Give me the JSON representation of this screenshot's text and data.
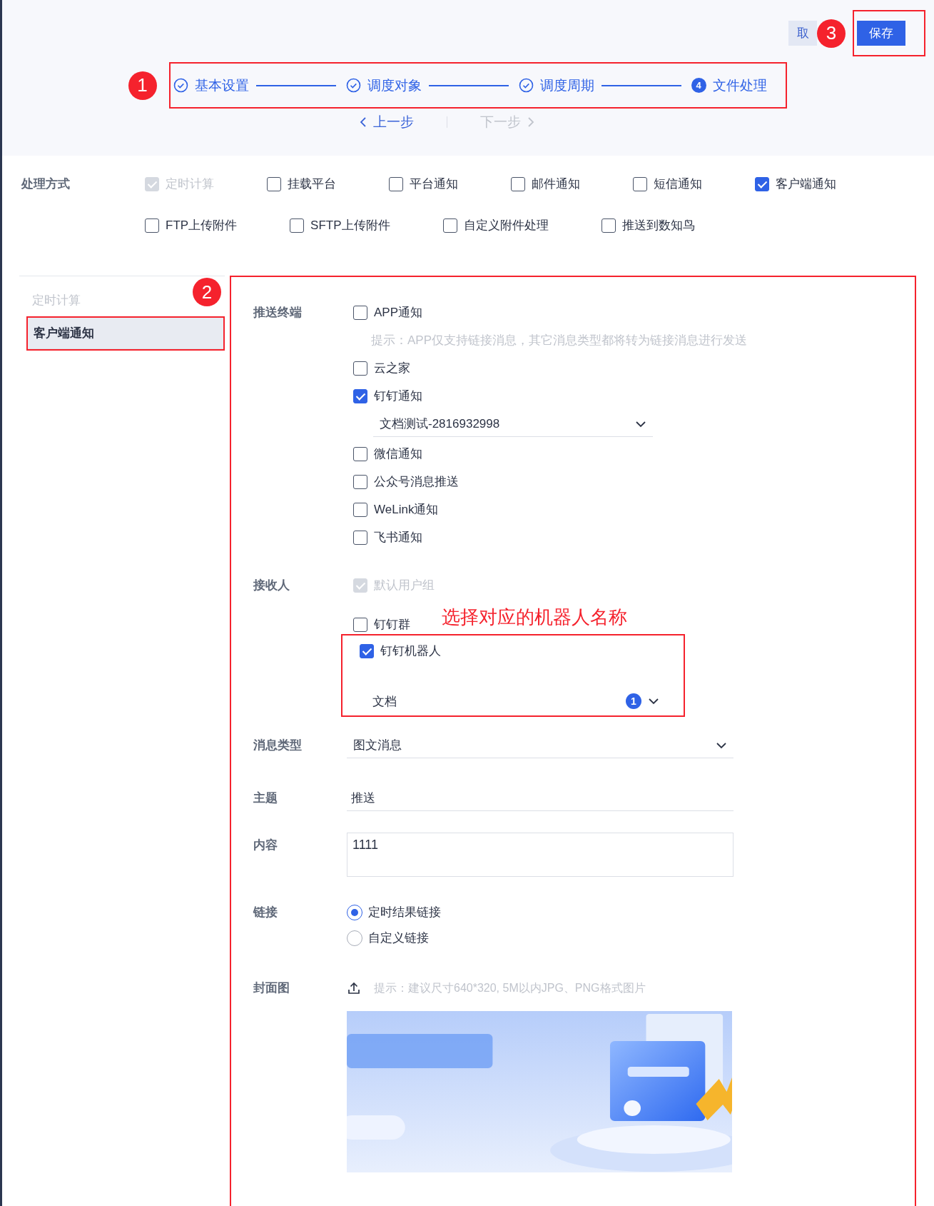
{
  "header": {
    "cancel_button": "取",
    "save_button": "保存",
    "save_callout": "3",
    "steps_callout": "1",
    "steps": [
      {
        "label": "基本设置",
        "done": true
      },
      {
        "label": "调度对象",
        "done": true
      },
      {
        "label": "调度周期",
        "done": true
      },
      {
        "label": "文件处理",
        "done": false,
        "number": "4"
      }
    ],
    "prev_button": {
      "label": "上一步",
      "disabled": false
    },
    "next_button": {
      "label": "下一步",
      "disabled": true
    }
  },
  "methods": {
    "label": "处理方式",
    "options": [
      {
        "label": "定时计算",
        "checked": true,
        "disabled": true
      },
      {
        "label": "挂载平台",
        "checked": false,
        "disabled": false
      },
      {
        "label": "平台通知",
        "checked": false,
        "disabled": false
      },
      {
        "label": "邮件通知",
        "checked": false,
        "disabled": false
      },
      {
        "label": "短信通知",
        "checked": false,
        "disabled": false
      },
      {
        "label": "客户端通知",
        "checked": true,
        "disabled": false
      },
      {
        "label": "FTP上传附件",
        "checked": false,
        "disabled": false
      },
      {
        "label": "SFTP上传附件",
        "checked": false,
        "disabled": false
      },
      {
        "label": "自定义附件处理",
        "checked": false,
        "disabled": false
      },
      {
        "label": "推送到数知鸟",
        "checked": false,
        "disabled": false
      }
    ]
  },
  "sidebar": {
    "callout": "2",
    "items": [
      {
        "label": "定时计算",
        "selected": false,
        "disabled": true
      },
      {
        "label": "客户端通知",
        "selected": true,
        "disabled": false
      }
    ]
  },
  "form": {
    "push_terminal": {
      "label": "推送终端",
      "items": [
        {
          "kind": "checkbox",
          "label": "APP通知",
          "checked": false,
          "disabled": false
        },
        {
          "kind": "hint",
          "text": "提示：APP仅支持链接消息，其它消息类型都将转为链接消息进行发送"
        },
        {
          "kind": "checkbox",
          "label": "云之家",
          "checked": false,
          "disabled": false
        },
        {
          "kind": "checkbox",
          "label": "钉钉通知",
          "checked": true,
          "disabled": false
        },
        {
          "kind": "select",
          "value": "文档测试-2816932998"
        },
        {
          "kind": "checkbox",
          "label": "微信通知",
          "checked": false,
          "disabled": false
        },
        {
          "kind": "checkbox",
          "label": "公众号消息推送",
          "checked": false,
          "disabled": false
        },
        {
          "kind": "checkbox",
          "label": "WeLink通知",
          "checked": false,
          "disabled": false
        },
        {
          "kind": "checkbox",
          "label": "飞书通知",
          "checked": false,
          "disabled": false
        }
      ]
    },
    "receivers": {
      "label": "接收人",
      "annotation": "选择对应的机器人名称",
      "default_group": {
        "label": "默认用户组",
        "checked": true,
        "disabled": true
      },
      "group": {
        "label": "钉钉群",
        "checked": false,
        "disabled": false
      },
      "robot": {
        "label": "钉钉机器人",
        "checked": true,
        "disabled": false
      },
      "robot_select": {
        "value": "文档",
        "count": "1"
      }
    },
    "message_type": {
      "label": "消息类型",
      "value": "图文消息"
    },
    "subject": {
      "label": "主题",
      "value": "推送"
    },
    "content": {
      "label": "内容",
      "value": "1111"
    },
    "link": {
      "label": "链接",
      "options": [
        {
          "label": "定时结果链接",
          "selected": true
        },
        {
          "label": "自定义链接",
          "selected": false
        }
      ]
    },
    "cover": {
      "label": "封面图",
      "hint": "提示：建议尺寸640*320, 5M以内JPG、PNG格式图片"
    }
  }
}
